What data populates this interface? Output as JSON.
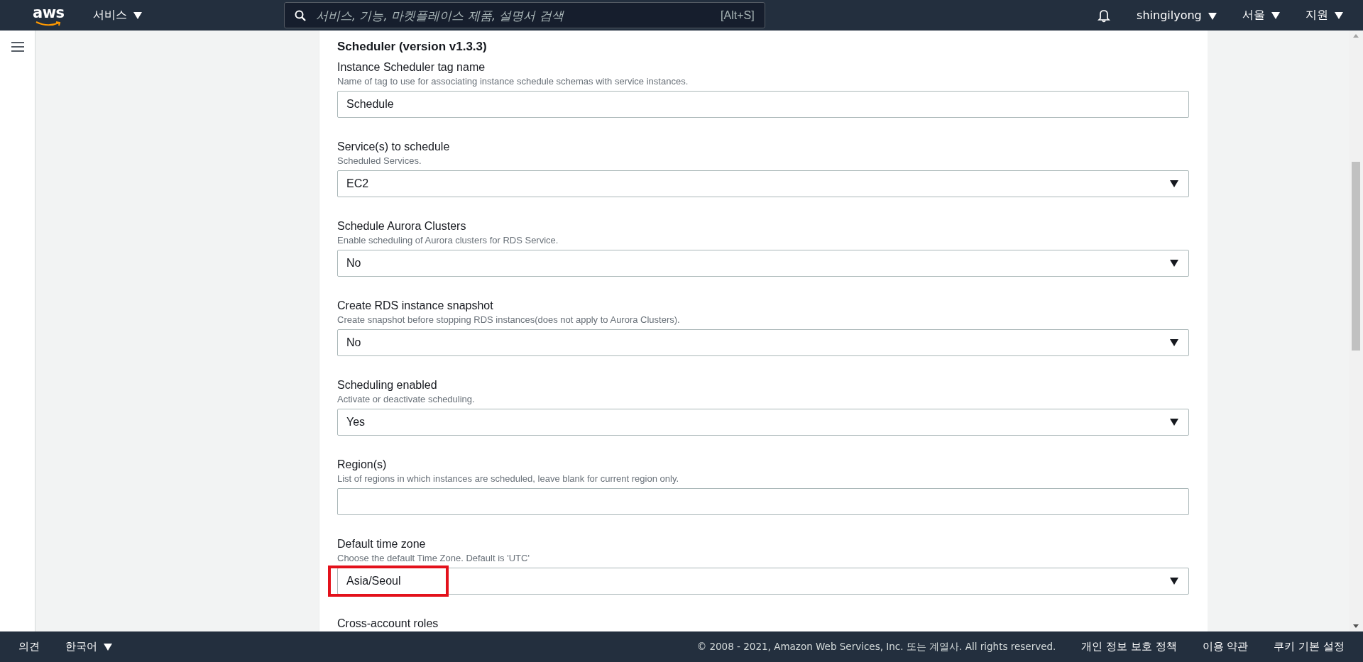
{
  "top_bar": {
    "logo": "aws",
    "services_menu": "서비스",
    "search": {
      "placeholder": "서비스, 기능, 마켓플레이스 제품, 설명서 검색",
      "shortcut": "[Alt+S]"
    },
    "user_menu": "shingilyong",
    "region_menu": "서울",
    "support_menu": "지원"
  },
  "section": {
    "title": "Scheduler (version v1.3.3)",
    "fields": [
      {
        "kind": "text",
        "label": "Instance Scheduler tag name",
        "description": "Name of tag to use for associating instance schedule schemas with service instances.",
        "value": "Schedule"
      },
      {
        "kind": "select",
        "label": "Service(s) to schedule",
        "description": "Scheduled Services.",
        "value": "EC2"
      },
      {
        "kind": "select",
        "label": "Schedule Aurora Clusters",
        "description": "Enable scheduling of Aurora clusters for RDS Service.",
        "value": "No"
      },
      {
        "kind": "select",
        "label": "Create RDS instance snapshot",
        "description": "Create snapshot before stopping RDS instances(does not apply to Aurora Clusters).",
        "value": "No"
      },
      {
        "kind": "select",
        "label": "Scheduling enabled",
        "description": "Activate or deactivate scheduling.",
        "value": "Yes"
      },
      {
        "kind": "text",
        "label": "Region(s)",
        "description": "List of regions in which instances are scheduled, leave blank for current region only."
      },
      {
        "kind": "select",
        "label": "Default time zone",
        "description": "Choose the default Time Zone. Default is 'UTC'",
        "value": "Asia/Seoul",
        "highlighted": true
      },
      {
        "label": "Cross-account roles"
      }
    ]
  },
  "footer": {
    "feedback": "의견",
    "language": "한국어",
    "copyright": "© 2008 - 2021, Amazon Web Services, Inc. 또는 계열사. All rights reserved.",
    "links": [
      "개인 정보 보호 정책",
      "이용 약관",
      "쿠키 기본 설정"
    ]
  }
}
